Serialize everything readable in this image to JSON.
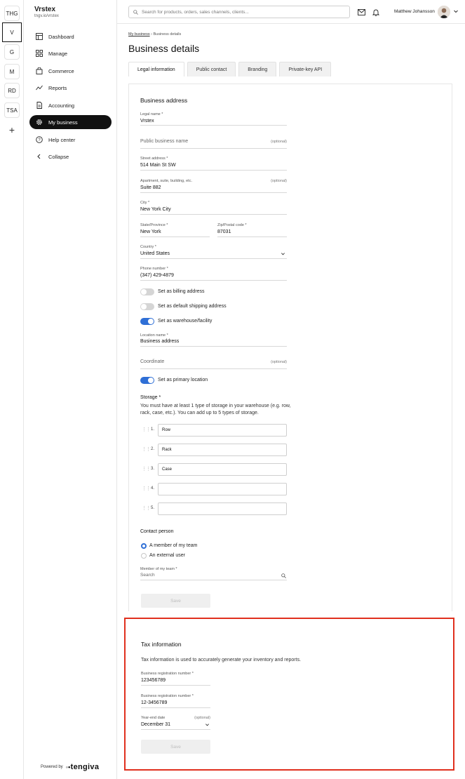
{
  "workspaces": [
    "THG",
    "V",
    "G",
    "M",
    "RD",
    "TSA"
  ],
  "workspace_add": "+",
  "brand": {
    "name": "Vrstex",
    "url": "tngv.io/vrstex"
  },
  "nav": [
    {
      "label": "Dashboard",
      "icon": "dashboard-icon"
    },
    {
      "label": "Manage",
      "icon": "grid-icon"
    },
    {
      "label": "Commerce",
      "icon": "bag-icon"
    },
    {
      "label": "Reports",
      "icon": "chart-icon"
    },
    {
      "label": "Accounting",
      "icon": "document-icon"
    },
    {
      "label": "My business",
      "icon": "gear-icon",
      "active": true
    },
    {
      "label": "Help center",
      "icon": "help-icon"
    },
    {
      "label": "Collapse",
      "icon": "chevron-left-icon"
    }
  ],
  "powered": {
    "prefix": "Powered by",
    "logo": "tengiva"
  },
  "topbar": {
    "search_placeholder": "Search for products, orders, sales channels, clients...",
    "user_name": "Matthew Johansson"
  },
  "breadcrumb": {
    "parent": "My business",
    "separator": "›",
    "current": "Business details"
  },
  "page_title": "Business details",
  "tabs": [
    "Legal information",
    "Public contact",
    "Branding",
    "Private-key API"
  ],
  "business_address": {
    "title": "Business address",
    "legal_name": {
      "label": "Legal name *",
      "value": "Vrstex"
    },
    "public_name": {
      "placeholder": "Public business name",
      "optional": "(optional)"
    },
    "street": {
      "label": "Street address *",
      "value": "514 Main St SW"
    },
    "apartment": {
      "label": "Apartment, suite, building, etc.",
      "optional": "(optional)",
      "value": "Suite 882"
    },
    "city": {
      "label": "City *",
      "value": "New York City"
    },
    "state": {
      "label": "State/Province *",
      "value": "New York"
    },
    "zip": {
      "label": "Zip/Postal code *",
      "value": "87031"
    },
    "country": {
      "label": "Country *",
      "value": "United States"
    },
    "phone": {
      "label": "Phone number *",
      "value": "(347) 429-4879"
    },
    "toggles": [
      {
        "label": "Set as billing address",
        "on": false
      },
      {
        "label": "Set as default shipping address",
        "on": false
      },
      {
        "label": "Set as warehouse/facility",
        "on": true
      }
    ],
    "location_name": {
      "label": "Location name *",
      "value": "Business address"
    },
    "coordinate": {
      "placeholder": "Coordinate",
      "optional": "(optional)"
    },
    "primary_toggle": {
      "label": "Set as primary location",
      "on": true
    },
    "storage": {
      "title": "Storage *",
      "description": "You must have at least 1 type of storage in your warehouse (e.g. row, rack, case, etc.). You can add up to 5 types of storage.",
      "items": [
        {
          "num": "1.",
          "value": "Row"
        },
        {
          "num": "2.",
          "value": "Rack"
        },
        {
          "num": "3.",
          "value": "Case"
        },
        {
          "num": "4.",
          "value": ""
        },
        {
          "num": "5.",
          "value": ""
        }
      ]
    },
    "contact": {
      "title": "Contact person",
      "options": [
        {
          "label": "A member of my team",
          "selected": true
        },
        {
          "label": "An external user",
          "selected": false
        }
      ],
      "member": {
        "label": "Member of my team *",
        "placeholder": "Search"
      }
    },
    "save_label": "Save"
  },
  "tax": {
    "title": "Tax information",
    "description": "Tax information is used to accurately generate your inventory and reports.",
    "reg1": {
      "label": "Business registration number *",
      "value": "123456789"
    },
    "reg2": {
      "label": "Business registration number *",
      "value": "12-3456789"
    },
    "year_end": {
      "label": "Year-end date",
      "optional": "(optional)",
      "value": "December 31"
    },
    "save_label": "Save"
  },
  "colors": {
    "accent": "#2f6fd6",
    "highlight": "#e0301e",
    "active_nav": "#111111"
  }
}
